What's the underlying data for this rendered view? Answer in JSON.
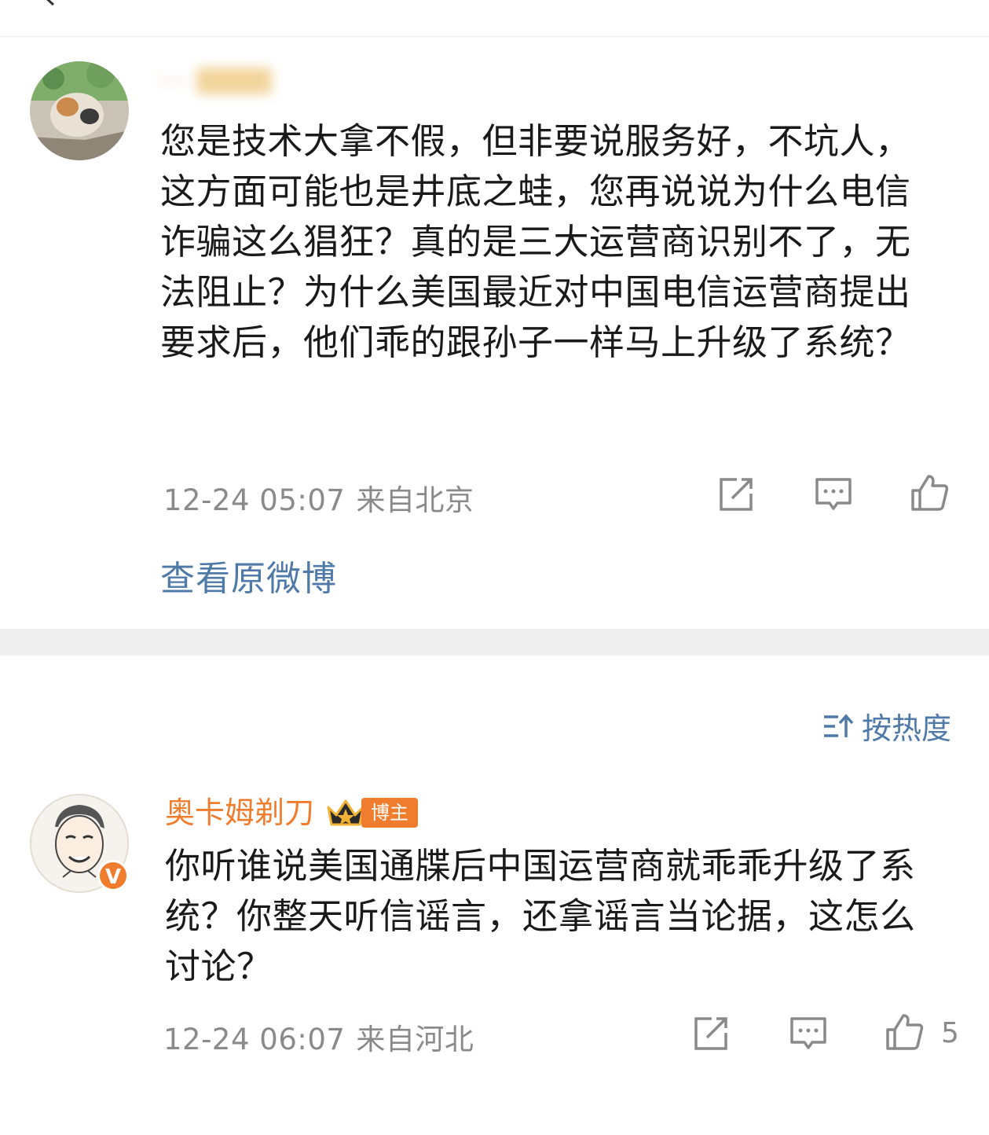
{
  "comment1": {
    "username": "···",
    "text": "您是技术大拿不假，但非要说服务好，不坑人，这方面可能也是井底之蛙，您再说说为什么电信诈骗这么猖狂？真的是三大运营商识别不了，无法阻止？为什么美国最近对中国电信运营商提出要求后，他们乖的跟孙子一样马上升级了系统？",
    "time": "12-24 05:07",
    "location": "来自北京"
  },
  "view_original_label": "查看原微博",
  "sort": {
    "label": "按热度"
  },
  "comment2": {
    "username": "奥卡姆剃刀",
    "badge_label": "博主",
    "verified_mark": "V",
    "text": "你听谁说美国通牒后中国运营商就乖乖升级了系统？你整天听信谣言，还拿谣言当论据，这怎么讨论？",
    "time": "12-24 06:07",
    "location": "来自河北",
    "like_count": "5"
  },
  "icons": {
    "back": "back-arrow-icon",
    "share": "share-icon",
    "comment": "comment-icon",
    "like": "like-icon",
    "sort": "sort-icon",
    "crown": "crown-icon"
  },
  "colors": {
    "accent_orange": "#f07d2e",
    "link_blue": "#4f7aa8",
    "meta_gray": "#8a8a8a"
  }
}
